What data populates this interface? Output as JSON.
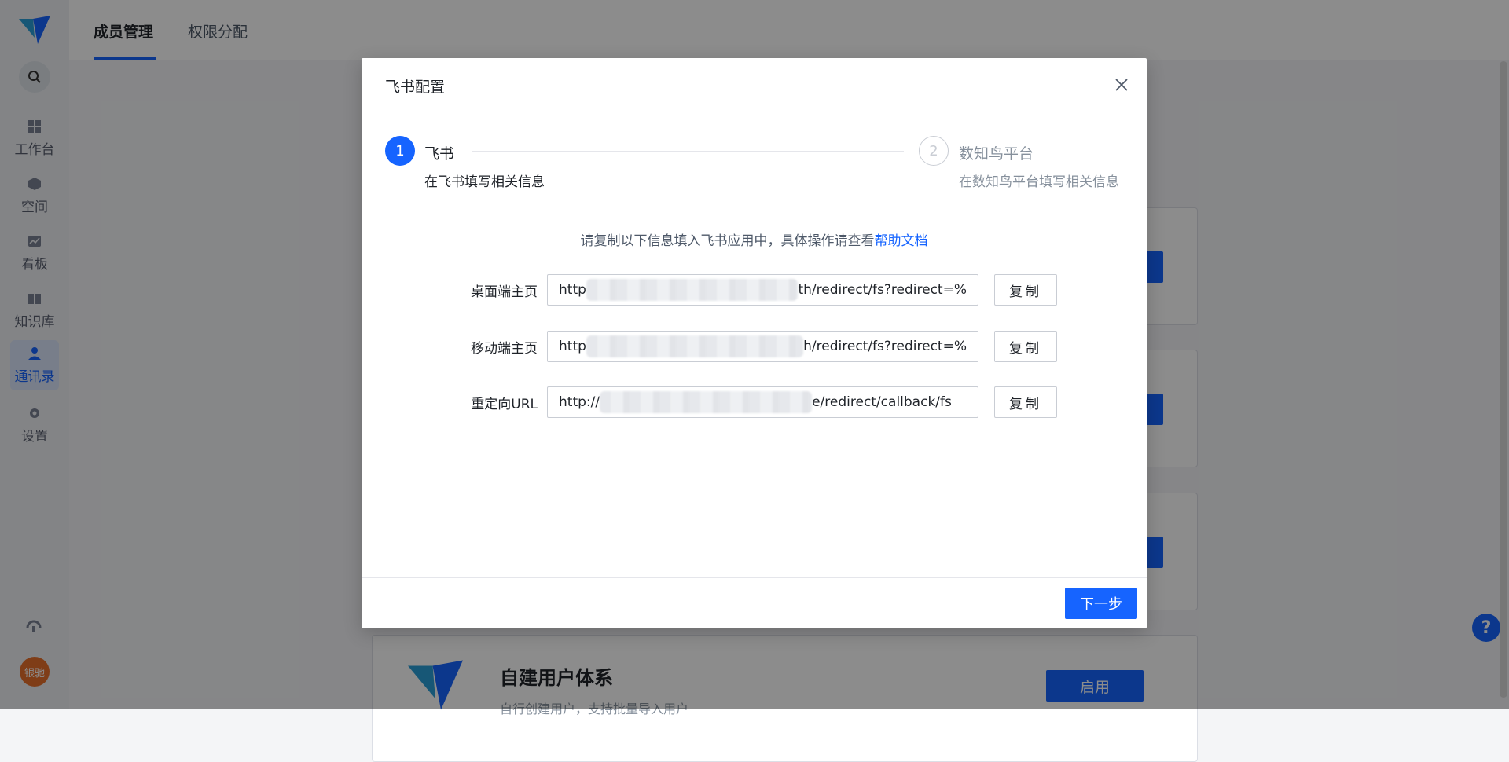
{
  "sidebar": {
    "items": [
      {
        "label": "工作台",
        "icon": "grid-icon"
      },
      {
        "label": "空间",
        "icon": "cube-icon"
      },
      {
        "label": "看板",
        "icon": "chart-icon"
      },
      {
        "label": "知识库",
        "icon": "book-icon"
      },
      {
        "label": "通讯录",
        "icon": "contacts-icon",
        "active": true
      },
      {
        "label": "设置",
        "icon": "gear-icon"
      }
    ],
    "avatar_text": "银驰"
  },
  "topbar": {
    "tabs": [
      {
        "label": "成员管理",
        "active": true
      },
      {
        "label": "权限分配",
        "active": false
      }
    ]
  },
  "background": {
    "bottom_card_title": "自建用户体系",
    "bottom_card_button": "启用",
    "bottom_card_sub": "自行创建用户，支持批量导入用户"
  },
  "modal": {
    "title": "飞书配置",
    "steps": [
      {
        "index": "1",
        "title": "飞书",
        "desc": "在飞书填写相关信息"
      },
      {
        "index": "2",
        "title": "数知鸟平台",
        "desc": "在数知鸟平台填写相关信息"
      }
    ],
    "hint_text": "请复制以下信息填入飞书应用中，具体操作请查看",
    "hint_link": "帮助文档",
    "fields": [
      {
        "label": "桌面端主页",
        "prefix": "http",
        "suffix": "th/redirect/fs?redirect=%",
        "copy": "复制"
      },
      {
        "label": "移动端主页",
        "prefix": "http",
        "suffix": "h/redirect/fs?redirect=%",
        "copy": "复制"
      },
      {
        "label": "重定向URL",
        "prefix": "http://",
        "suffix": "e/redirect/callback/fs",
        "copy": "复制"
      }
    ],
    "next_button": "下一步"
  },
  "colors": {
    "primary": "#1664ff",
    "avatar": "#e8702a"
  }
}
